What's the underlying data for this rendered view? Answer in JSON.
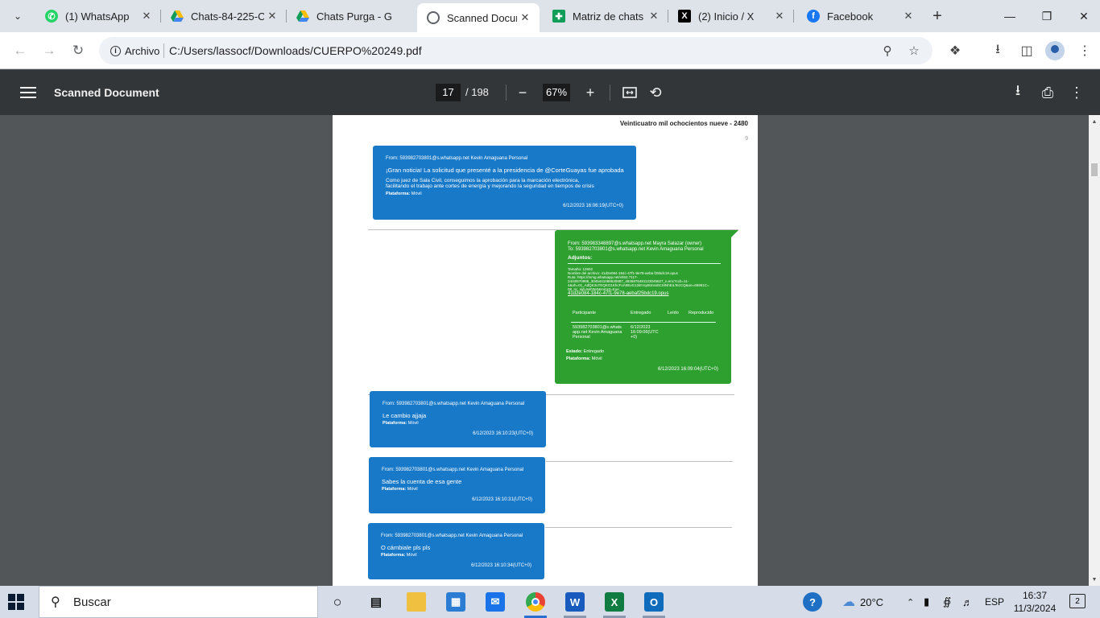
{
  "browser": {
    "tabs": [
      {
        "title": "(1) WhatsApp",
        "icon": "whatsapp-icon"
      },
      {
        "title": "Chats-84-225-C",
        "icon": "google-drive-icon"
      },
      {
        "title": "Chats Purga - G",
        "icon": "google-drive-icon"
      },
      {
        "title": "Scanned Docum",
        "icon": "chrome-pdf-icon",
        "active": true
      },
      {
        "title": "Matriz de chats",
        "icon": "google-sheets-icon"
      },
      {
        "title": "(2) Inicio / X",
        "icon": "x-icon"
      },
      {
        "title": "Facebook",
        "icon": "facebook-icon"
      }
    ],
    "site_chip": "Archivo",
    "url": "C:/Users/lassocf/Downloads/CUERPO%20249.pdf"
  },
  "pdf": {
    "title": "Scanned Document",
    "current_page": "17",
    "total_pages": "/ 198",
    "zoom": "67%"
  },
  "page": {
    "header": "Veinticuatro mil ochocientos nueve - 2480",
    "page_mark": "9",
    "messages": [
      {
        "from": "From: 593982703801@s.whatsapp.net Kevin Amaguana Personal",
        "lines": [
          "¡Gran noticia!  La solicitud que presenté a la presidencia de @CorteGuayas fue aprobada",
          "Como juez de Sala Civil, conseguimos la aprobación para la marcación electrónica,",
          "facilitando el trabajo ante cortes de energía y mejorando la seguridad en tiempos de crisis"
        ],
        "platform_label": "Plataforma:",
        "platform": "Móvil",
        "timestamp": "6/12/2023 16:06:19(UTC+0)"
      },
      {
        "from": "From: 593982703801@s.whatsapp.net Kevin Amaguana Personal",
        "lines": [
          "Le cambio ajjaja"
        ],
        "platform_label": "Plataforma:",
        "platform": "Móvil",
        "timestamp": "6/12/2023 16:10:23(UTC+0)"
      },
      {
        "from": "From: 593982703801@s.whatsapp.net Kevin Amaguana Personal",
        "lines": [
          "Sabes la cuenta de esa gente"
        ],
        "platform_label": "Plataforma:",
        "platform": "Móvil",
        "timestamp": "6/12/2023 16:10:31(UTC+0)"
      },
      {
        "from": "From: 593982703801@s.whatsapp.net Kevin Amaguana Personal",
        "lines": [
          "O cámbiale pls pls"
        ],
        "platform_label": "Plataforma:",
        "platform": "Móvil",
        "timestamp": "6/12/2023 16:10:34(UTC+0)"
      }
    ],
    "outgoing": {
      "from": "From: 593983348897@s.whatsapp.net Mayra Salazar (owner)",
      "to": "To: 593982703801@s.whatsapp.net Kevin Amaguana Personal",
      "attachments_label": "Adjuntos:",
      "size": "Tamaño: 12602",
      "filename": "Nombre del archivo: 41d2e084-184c-47f1-9e78-aeba f25bdc19.opus",
      "path1": "Ruta: https://mmg.whatsapp.net/v/t62.7117-",
      "path2": "24/40570986_3045441088630887_4836876481123045627_n.enc?ccb=11-",
      "path3": "4&oh=01_AdQK3uTEQKO1KhcFuA9EvG12iEVq48mss0CSINhEiLTezCQ&oe=65961C=",
      "path4": "08_nc_sid=5e03e0&mms3=true",
      "link": "41d2e084-184c-47f1-9e78-aebaf25bdc19.opus",
      "cols": [
        "Participante",
        "Entregado",
        "Leído",
        "Reproducido"
      ],
      "participant": "593982703801@s.whats app.net Kevin Amaguana Personal",
      "delivered": "6/12/2023 16:09:06(UTC +0)",
      "status_label": "Estado:",
      "status": "Entregado",
      "platform_label": "Plataforma:",
      "platform": "Móvil",
      "timestamp": "6/12/2023 16:09:04(UTC+0)"
    }
  },
  "taskbar": {
    "search_placeholder": "Buscar",
    "weather": "20°C",
    "language": "ESP",
    "time": "16:37",
    "date": "11/3/2024",
    "notifications": "2"
  },
  "colors": {
    "incoming_bubble": "#1879c8",
    "outgoing_bubble": "#2da02f",
    "pdf_toolbar": "#323639",
    "doc_background": "#525659"
  }
}
